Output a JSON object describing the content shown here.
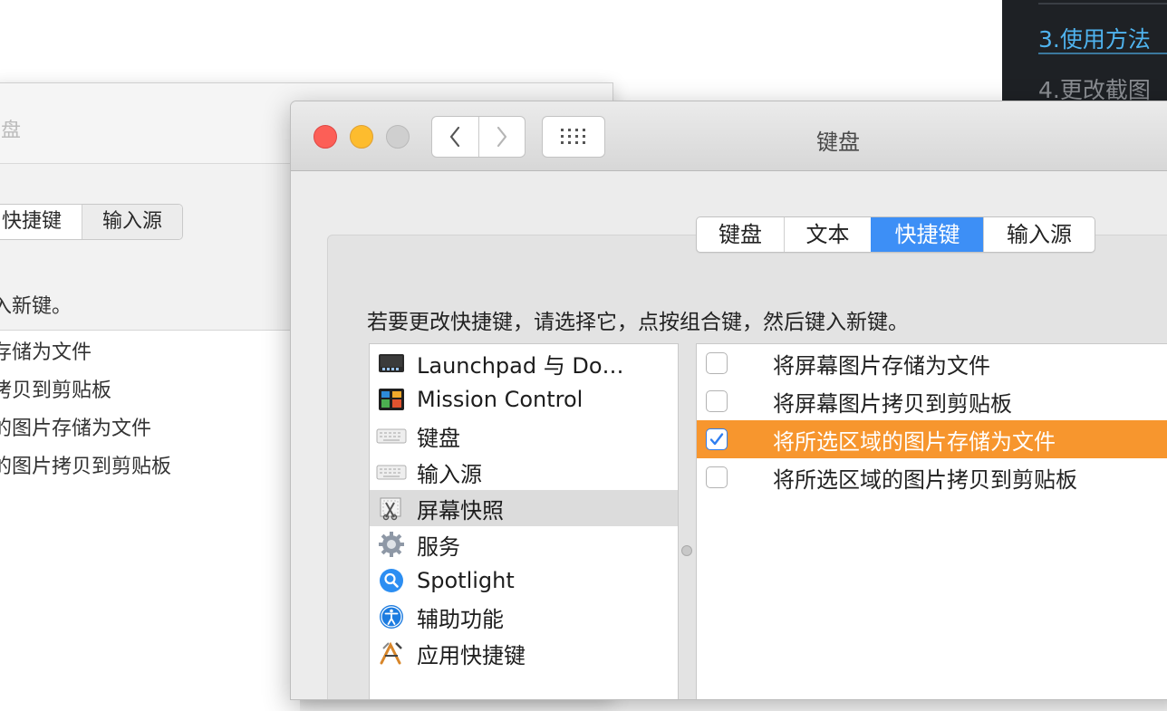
{
  "doc_toc": {
    "active_link": "3.使用方法",
    "next_link": "4.更改截图"
  },
  "bg_window": {
    "title": "盘",
    "tabs": [
      "快捷键",
      "输入源"
    ],
    "instruction": "入新键。",
    "items": [
      "存储为文件",
      "拷贝到剪贴板",
      "的图片存储为文件",
      "的图片拷贝到剪贴板"
    ]
  },
  "window": {
    "title": "键盘",
    "tabs": [
      {
        "label": "键盘",
        "selected": false
      },
      {
        "label": "文本",
        "selected": false
      },
      {
        "label": "快捷键",
        "selected": true
      },
      {
        "label": "输入源",
        "selected": false
      }
    ],
    "instruction": "若要更改快捷键，请选择它，点按组合键，然后键入新键。",
    "categories": [
      {
        "label": "Launchpad 与 Do…",
        "icon": "launchpad-icon",
        "selected": false
      },
      {
        "label": "Mission Control",
        "icon": "mission-control-icon",
        "selected": false
      },
      {
        "label": "键盘",
        "icon": "keyboard-icon",
        "selected": false
      },
      {
        "label": "输入源",
        "icon": "keyboard-icon",
        "selected": false
      },
      {
        "label": "屏幕快照",
        "icon": "screenshot-icon",
        "selected": true
      },
      {
        "label": "服务",
        "icon": "gear-icon",
        "selected": false
      },
      {
        "label": "Spotlight",
        "icon": "spotlight-icon",
        "selected": false
      },
      {
        "label": "辅助功能",
        "icon": "accessibility-icon",
        "selected": false
      },
      {
        "label": "应用快捷键",
        "icon": "app-shortcuts-icon",
        "selected": false
      }
    ],
    "shortcuts": [
      {
        "label": "将屏幕图片存储为文件",
        "checked": false,
        "selected": false
      },
      {
        "label": "将屏幕图片拷贝到剪贴板",
        "checked": false,
        "selected": false
      },
      {
        "label": "将所选区域的图片存储为文件",
        "checked": true,
        "selected": true
      },
      {
        "label": "将所选区域的图片拷贝到剪贴板",
        "checked": false,
        "selected": false
      }
    ]
  },
  "colors": {
    "selected_tab": "#3d8ff6",
    "selected_row": "#f7962e",
    "toc_link": "#4fb3ee"
  }
}
